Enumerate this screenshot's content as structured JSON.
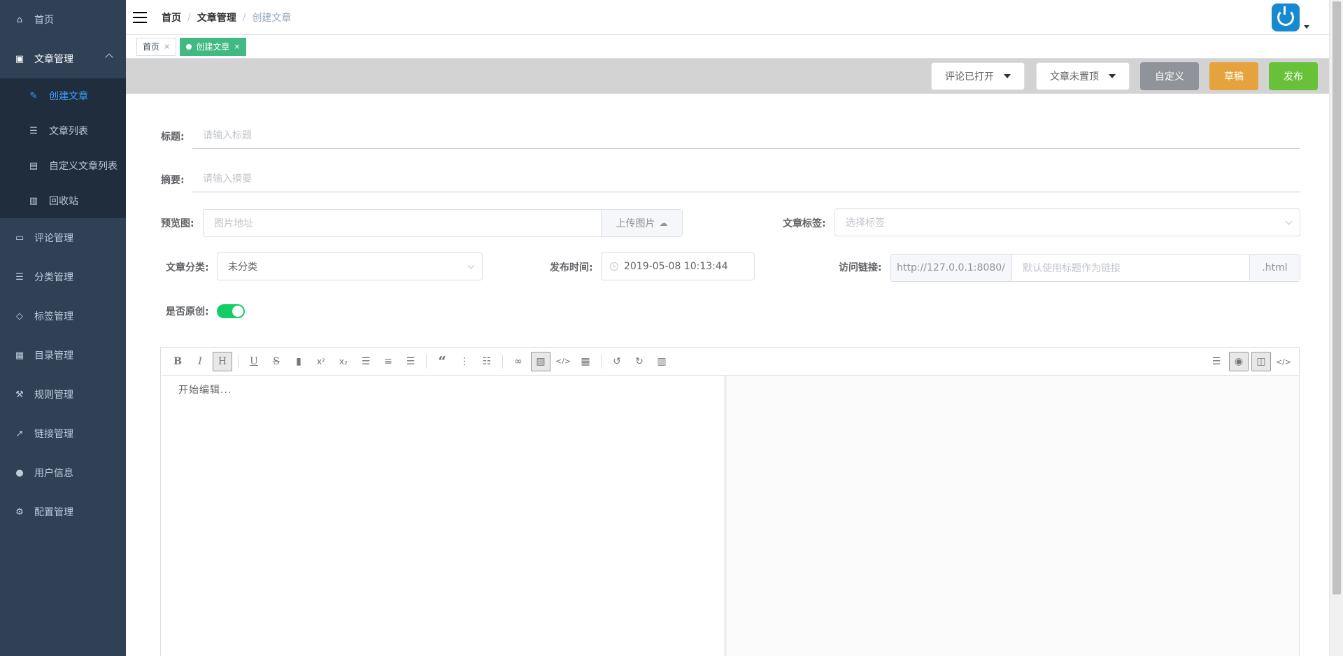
{
  "sidebar": {
    "items": [
      {
        "label": "首页",
        "icon": "home-icon"
      },
      {
        "label": "文章管理",
        "icon": "document-icon",
        "open": true
      },
      {
        "label": "评论管理",
        "icon": "comment-icon"
      },
      {
        "label": "分类管理",
        "icon": "list-icon"
      },
      {
        "label": "标签管理",
        "icon": "tag-icon"
      },
      {
        "label": "目录管理",
        "icon": "catalog-icon"
      },
      {
        "label": "规则管理",
        "icon": "rule-icon"
      },
      {
        "label": "链接管理",
        "icon": "external-link-icon"
      },
      {
        "label": "用户信息",
        "icon": "user-icon"
      },
      {
        "label": "配置管理",
        "icon": "gear-icon"
      }
    ],
    "submenu": [
      {
        "label": "创建文章",
        "icon": "edit-icon",
        "active": true
      },
      {
        "label": "文章列表",
        "icon": "list-icon"
      },
      {
        "label": "自定义文章列表",
        "icon": "custom-doc-icon"
      },
      {
        "label": "回收站",
        "icon": "trash-icon"
      }
    ]
  },
  "breadcrumb": [
    "首页",
    "文章管理",
    "创建文章"
  ],
  "tags": [
    {
      "label": "首页",
      "active": false
    },
    {
      "label": "创建文章",
      "active": true
    }
  ],
  "actions": {
    "comment": "评论已打开",
    "top": "文章未置顶",
    "custom": "自定义",
    "draft": "草稿",
    "publish": "发布"
  },
  "form": {
    "title_label": "标题:",
    "title_placeholder": "请输入标题",
    "summary_label": "摘要:",
    "summary_placeholder": "请输入摘要",
    "preview_label": "预览图:",
    "preview_placeholder": "图片地址",
    "upload_label": "上传图片",
    "tags_label": "文章标签:",
    "tags_placeholder": "选择标签",
    "category_label": "文章分类:",
    "category_value": "未分类",
    "publish_time_label": "发布时间:",
    "publish_time_value": "2019-05-08 10:13:44",
    "link_label": "访问链接:",
    "link_prefix": "http://127.0.0.1:8080/",
    "link_placeholder": "默认使用标题作为链接",
    "link_suffix": ".html",
    "original_label": "是否原创:",
    "original_on": true
  },
  "editor": {
    "placeholder": "开始编辑...",
    "toolbar_left": [
      "B",
      "I",
      "H",
      "U",
      "S",
      "bookmark",
      "x²",
      "x₂",
      "align-left",
      "align-center",
      "align-right",
      "quote",
      "ordered-list",
      "unordered-list",
      "link",
      "image",
      "code",
      "table",
      "undo",
      "redo",
      "trash"
    ],
    "toolbar_right": [
      "menu",
      "preview",
      "split",
      "source"
    ]
  },
  "colors": {
    "sidebar_bg": "#304156",
    "submenu_bg": "#1f2d3d",
    "active_blue": "#409eff",
    "tag_green": "#42b983",
    "draft_orange": "#e6a23c",
    "publish_green": "#67c23a",
    "custom_gray": "#909399",
    "switch_green": "#13ce66"
  }
}
